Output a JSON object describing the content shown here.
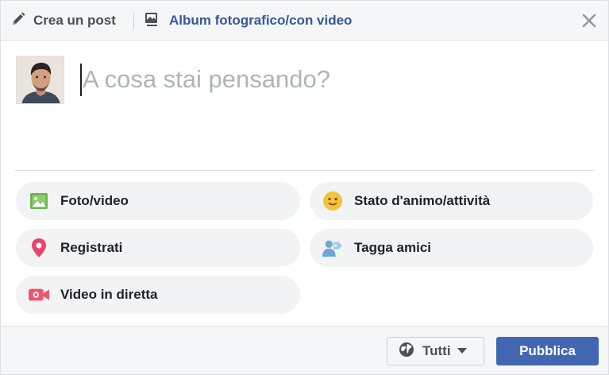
{
  "header": {
    "create_post_label": "Crea un post",
    "album_label": "Album fotografico/con video"
  },
  "composer": {
    "placeholder": "A cosa stai pensando?"
  },
  "actions": [
    {
      "label": "Foto/video",
      "icon": "photo-video-icon",
      "color": "#6bb54a"
    },
    {
      "label": "Stato d'animo/attività",
      "icon": "smiley-icon",
      "color": "#f5c33b"
    },
    {
      "label": "Registrati",
      "icon": "location-pin-icon",
      "color": "#e9446a"
    },
    {
      "label": "Tagga amici",
      "icon": "tag-friends-icon",
      "color": "#6fa6d6"
    },
    {
      "label": "Video in diretta",
      "icon": "live-video-icon",
      "color": "#f35369"
    }
  ],
  "footer": {
    "audience_label": "Tutti",
    "publish_label": "Pubblica"
  },
  "colors": {
    "brand": "#4267b2",
    "link": "#365899"
  }
}
